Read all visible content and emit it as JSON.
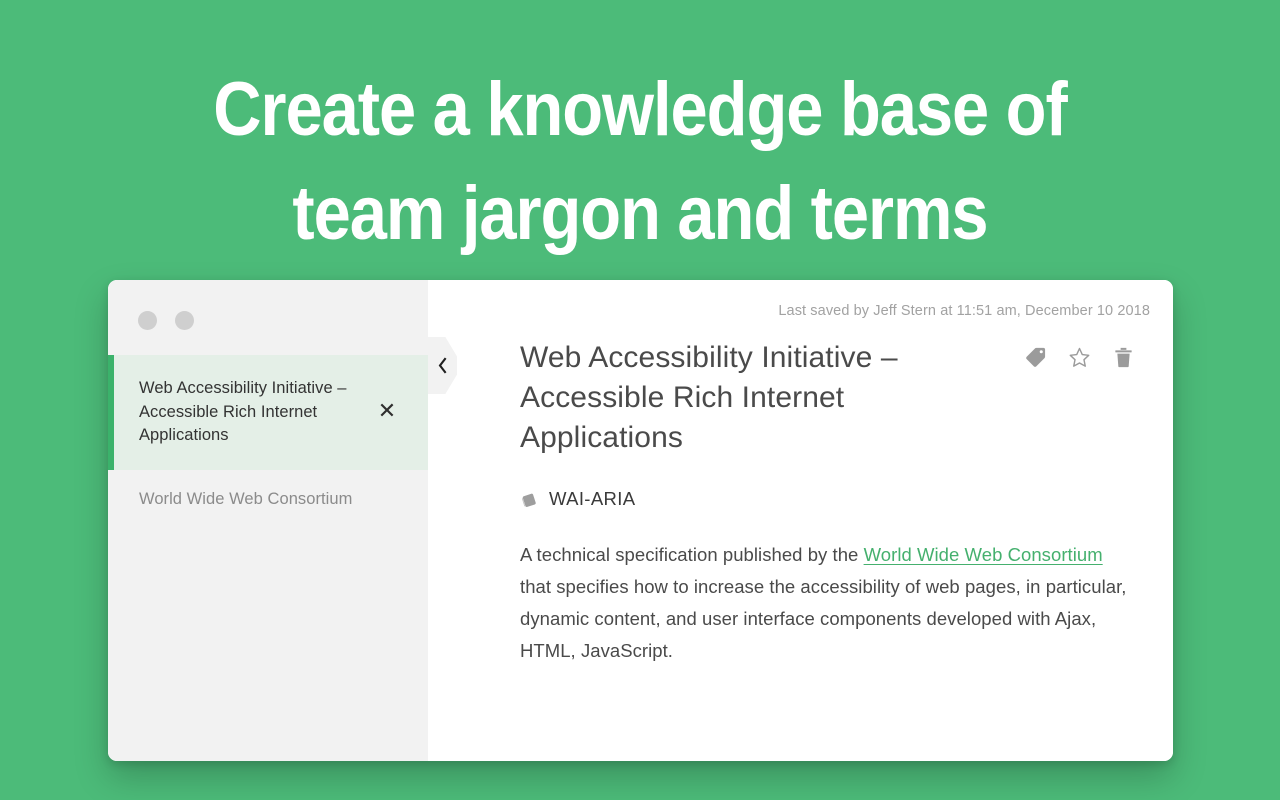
{
  "headline": "Create a knowledge base of team jargon and terms",
  "colors": {
    "background_green": "#4CBB79",
    "accent_green": "#3BB26B",
    "link_green": "#45B06E",
    "active_item_bg": "#E4EFE7",
    "sidebar_bg": "#F2F2F2"
  },
  "window": {
    "titlebar": {
      "dot_one": "window-dot",
      "dot_two": "window-dot"
    },
    "sidebar": {
      "collapse_label": "‹",
      "items": [
        {
          "label": "Web Accessibility Initiative – Accessible Rich Internet Applications",
          "active": true,
          "close_label": "✕"
        },
        {
          "label": "World Wide Web Consortium",
          "active": false,
          "close_label": ""
        }
      ]
    },
    "main": {
      "saved_status": "Last saved by Jeff Stern at 11:51 am, December 10 2018",
      "doc_title": "Web Accessibility Initiative – Accessible Rich Internet Applications",
      "actions": [
        {
          "icon": "tag-icon",
          "name": "tag-button"
        },
        {
          "icon": "star-icon",
          "name": "favorite-button"
        },
        {
          "icon": "trash-icon",
          "name": "delete-button"
        }
      ],
      "tag": {
        "icon": "tag-icon",
        "name": "WAI-ARIA"
      },
      "body": {
        "before_link": "A technical specification published by the ",
        "link_text": "World Wide Web Consortium",
        "after_link": " that specifies how to increase the accessibility of web pages, in particular, dynamic content, and user interface components developed with Ajax, HTML, JavaScript."
      }
    }
  }
}
